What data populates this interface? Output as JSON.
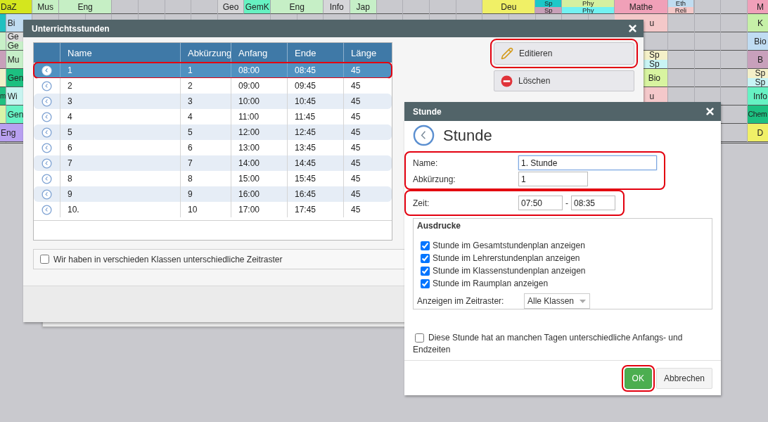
{
  "schedule": {
    "blocks": [
      {
        "text": "DaZ",
        "color": "#d4e61e"
      },
      {
        "text": "Mus",
        "color": "#c6efc4"
      },
      {
        "text": "Eng",
        "color": "#c6efc5"
      },
      {
        "text": "Geo",
        "color": "#d6d6d8"
      },
      {
        "text": "GemK",
        "color": "#66f2c2"
      },
      {
        "text": "Eng",
        "color": "#c6efc6"
      },
      {
        "text": "Info",
        "color": "#d6d6d9"
      },
      {
        "text": "Jap",
        "color": "#c6efc7"
      },
      {
        "text": "Deu",
        "color": "#f0f066"
      },
      {
        "parts": [
          {
            "text": "Sp",
            "color": "#1cc8c8"
          },
          {
            "text": "Sp",
            "color": "#c8a0b8"
          }
        ]
      },
      {
        "parts": [
          {
            "text": "Phy",
            "color": "#d4f0a0"
          },
          {
            "text": "Phy",
            "color": "#72f2f2"
          }
        ]
      },
      {
        "text": "Mathe",
        "color": "#f0a0b8"
      },
      {
        "parts": [
          {
            "text": "Eth",
            "color": "#c0dcf0"
          },
          {
            "text": "Reli",
            "color": "#f4c8c8"
          }
        ]
      },
      {
        "text": "M",
        "color": "#f0a0b9"
      },
      {
        "color": "#20c0c0"
      },
      {
        "text": "Bi",
        "color": "#c0dcf1"
      },
      {
        "text": "u",
        "color": "#f4c8c9"
      },
      {
        "text": "K",
        "color": "#c6f0a8"
      },
      {
        "color": "#c8f0c8"
      },
      {
        "parts": [
          {
            "text": "Ge",
            "color": "#dcdcdc"
          },
          {
            "text": "Ge",
            "color": "#c8f0c9"
          }
        ]
      },
      {
        "text": "Bio",
        "color": "#c0dcf2"
      },
      {
        "color": "#c8a0ba"
      },
      {
        "text": "Mu",
        "color": "#c6efc8"
      },
      {
        "parts": [
          {
            "text": "Sp",
            "color": "#f4f0c8"
          },
          {
            "text": "Sp",
            "color": "#c8f4f4"
          }
        ]
      },
      {
        "text": "B",
        "color": "#c8a0bb"
      },
      {
        "color": "#f0f0c8"
      },
      {
        "text": "Gen",
        "color": "#1cc080"
      },
      {
        "text": "Bio",
        "color": "#d8f4a0"
      },
      {
        "parts": [
          {
            "text": "Sp",
            "color": "#f4f0c9"
          },
          {
            "text": "Sp",
            "color": "#c8f4f5"
          }
        ]
      },
      {
        "text": "m",
        "color": "#20c081"
      },
      {
        "text": "Wi",
        "color": "#c8f4f0"
      },
      {
        "text": "u",
        "color": "#f4c8ca"
      },
      {
        "text": "Info",
        "color": "#66f2c3"
      },
      {
        "color": "#d8f4a8"
      },
      {
        "text": "Gen",
        "color": "#66f2c4"
      },
      {
        "text": "Chem",
        "color": "#1cc081"
      },
      {
        "text": "Eng",
        "color": "#b8a0f0"
      },
      {
        "text": "D",
        "color": "#f0f067"
      }
    ]
  },
  "lessons_dialog": {
    "title": "Unterrichtsstunden",
    "columns": [
      "Name",
      "Abkürzung",
      "Anfang",
      "Ende",
      "Länge"
    ],
    "rows": [
      {
        "name": "1",
        "abbr": "1",
        "start": "08:00",
        "end": "08:45",
        "length": "45",
        "selected": true,
        "highlighted": true
      },
      {
        "name": "2",
        "abbr": "2",
        "start": "09:00",
        "end": "09:45",
        "length": "45",
        "selected": false,
        "highlighted": false
      },
      {
        "name": "3",
        "abbr": "3",
        "start": "10:00",
        "end": "10:45",
        "length": "45",
        "selected": false,
        "highlighted": false
      },
      {
        "name": "4",
        "abbr": "4",
        "start": "11:00",
        "end": "11:45",
        "length": "45",
        "selected": false,
        "highlighted": false
      },
      {
        "name": "5",
        "abbr": "5",
        "start": "12:00",
        "end": "12:45",
        "length": "45",
        "selected": false,
        "highlighted": false
      },
      {
        "name": "6",
        "abbr": "6",
        "start": "13:00",
        "end": "13:45",
        "length": "45",
        "selected": false,
        "highlighted": false
      },
      {
        "name": "7",
        "abbr": "7",
        "start": "14:00",
        "end": "14:45",
        "length": "45",
        "selected": false,
        "highlighted": false
      },
      {
        "name": "8",
        "abbr": "8",
        "start": "15:00",
        "end": "15:45",
        "length": "45",
        "selected": false,
        "highlighted": false
      },
      {
        "name": "9",
        "abbr": "9",
        "start": "16:00",
        "end": "16:45",
        "length": "45",
        "selected": false,
        "highlighted": false
      },
      {
        "name": "10.",
        "abbr": "10",
        "start": "17:00",
        "end": "17:45",
        "length": "45",
        "selected": false,
        "highlighted": false
      }
    ],
    "option": {
      "label": "Wir haben in verschieden Klassen unterschiedliche Zeitraster",
      "checked": false
    },
    "actions": [
      {
        "kind": "edit",
        "label": "Editieren",
        "highlighted": true
      },
      {
        "kind": "delete",
        "label": "Löschen",
        "highlighted": false
      }
    ]
  },
  "lesson_dialog": {
    "title": "Stunde",
    "heading": "Stunde",
    "identity": {
      "highlighted": true,
      "fields": [
        {
          "label": "Name:",
          "value": "1. Stunde",
          "focused": true,
          "kind": "wide"
        },
        {
          "label": "Abkürzung:",
          "value": "1",
          "focused": false,
          "kind": "short"
        }
      ]
    },
    "time": {
      "highlighted": true,
      "label": "Zeit:",
      "start": "07:50",
      "separator": "-",
      "end": "08:35"
    },
    "printouts": {
      "legend": "Ausdrucke",
      "options": [
        {
          "label": "Stunde im Gesamtstundenplan anzeigen",
          "checked": true
        },
        {
          "label": "Stunde im Lehrerstundenplan anzeigen",
          "checked": true
        },
        {
          "label": "Stunde im Klassenstundenplan anzeigen",
          "checked": true
        },
        {
          "label": "Stunde im Raumplan anzeigen",
          "checked": true
        }
      ],
      "grid_label": "Anzeigen im Zeitraster:",
      "grid_value": "Alle Klassen"
    },
    "varying_times": {
      "label": "Diese Stunde hat an manchen Tagen unterschiedliche Anfangs- und Endzeiten",
      "checked": false
    },
    "buttons": [
      {
        "kind": "primary",
        "label": "OK",
        "highlighted": true
      },
      {
        "kind": "secondary",
        "label": "Abbrechen",
        "highlighted": false
      }
    ]
  }
}
